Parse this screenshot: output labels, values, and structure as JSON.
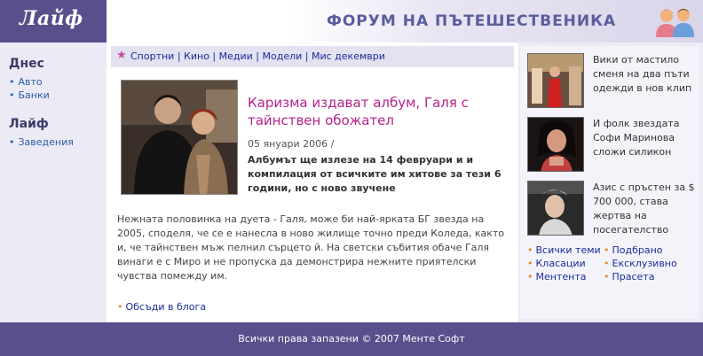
{
  "header": {
    "logo": "Лайф",
    "banner_title": "ФОРУМ НА ПЪТЕШЕСТВЕНИКА"
  },
  "leftnav": {
    "sections": [
      {
        "title": "Днес",
        "items": [
          "Авто",
          "Банки"
        ]
      },
      {
        "title": "Лайф",
        "items": [
          "Заведения"
        ]
      }
    ]
  },
  "categories": [
    "Спортни",
    "Кино",
    "Медии",
    "Модели",
    "Мис декември"
  ],
  "category_separator": " | ",
  "article": {
    "headline": "Каризма издават албум, Галя с тайнствен обожател",
    "date": "05 януари 2006 /",
    "lead": "Албумът ще излезе на 14 февруари и и компилация от всичките им хитове за тези 6 години, но с ново звучене",
    "body": "Нежната половинка на дуета - Галя, може би най-ярката БГ звезда на 2005, споделя, че се е нанесла в ново жилище точно преди Коледа, както и, че тайнствен мъж пелнил сърцето й. На светски събития обаче Галя винаги е с Миро и не пропуска да демонстрира нежните приятелски чувства помежду им.",
    "blog_link": "Обсъди в блога"
  },
  "side_news": [
    {
      "text": "Вики от мастило сменя на два пъти одежди в нов клип"
    },
    {
      "text": "И фолк звездата Софи Маринова сложи силикон"
    },
    {
      "text": "Азис с пръстен за $ 700 000, става жертва на посегателство"
    }
  ],
  "side_links": {
    "left": [
      "Всички теми",
      "Класации",
      "Ментента"
    ],
    "right": [
      "Подбрано",
      "Ексклузивно",
      "Прасета"
    ]
  },
  "footer": {
    "text": "Всички права запазени © 2007 Менте Софт"
  },
  "colors": {
    "brand": "#5a4f8c",
    "headline": "#b5228c",
    "link": "#1a2d9a",
    "bullet": "#e08a2a"
  }
}
